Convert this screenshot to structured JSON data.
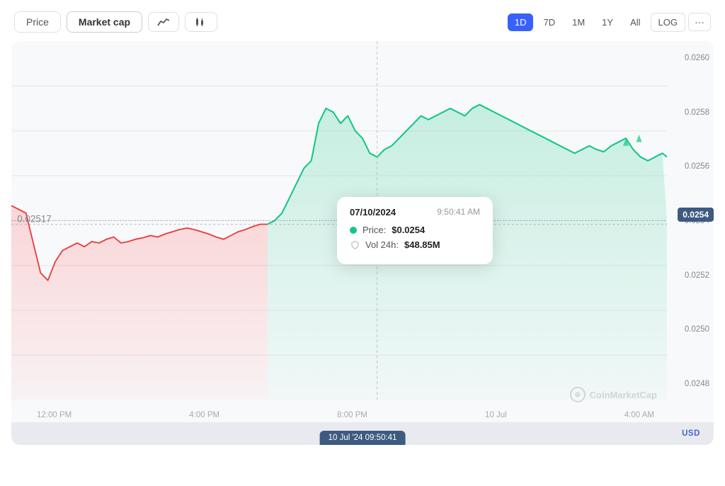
{
  "toolbar": {
    "tabs": [
      {
        "label": "Price",
        "active": false
      },
      {
        "label": "Market cap",
        "active": true
      }
    ],
    "icons": [
      {
        "name": "line-chart-icon",
        "symbol": "∿"
      },
      {
        "name": "candle-chart-icon",
        "symbol": "⊿⊿"
      }
    ],
    "timeframes": [
      {
        "label": "1D",
        "active": true
      },
      {
        "label": "7D",
        "active": false
      },
      {
        "label": "1M",
        "active": false
      },
      {
        "label": "1Y",
        "active": false
      },
      {
        "label": "All",
        "active": false
      },
      {
        "label": "LOG",
        "active": false,
        "isLog": true
      }
    ],
    "more_label": "···"
  },
  "chart": {
    "y_axis": [
      "0.0260",
      "0.0258",
      "0.0256",
      "0.0254",
      "0.0252",
      "0.0250",
      "0.0248"
    ],
    "x_axis": [
      "12:00 PM",
      "4:00 PM",
      "8:00 PM",
      "10 Jul",
      "4:00 AM"
    ],
    "current_price": "0.0254",
    "left_label": "0.02517",
    "currency": "USD",
    "timestamp": "10 Jul '24 09:50:41",
    "coinmarketcap": "CoinMarketCap"
  },
  "tooltip": {
    "date": "07/10/2024",
    "time": "9:50:41 AM",
    "price_label": "Price:",
    "price_value": "$0.0254",
    "vol_label": "Vol 24h:",
    "vol_value": "$48.85M"
  }
}
